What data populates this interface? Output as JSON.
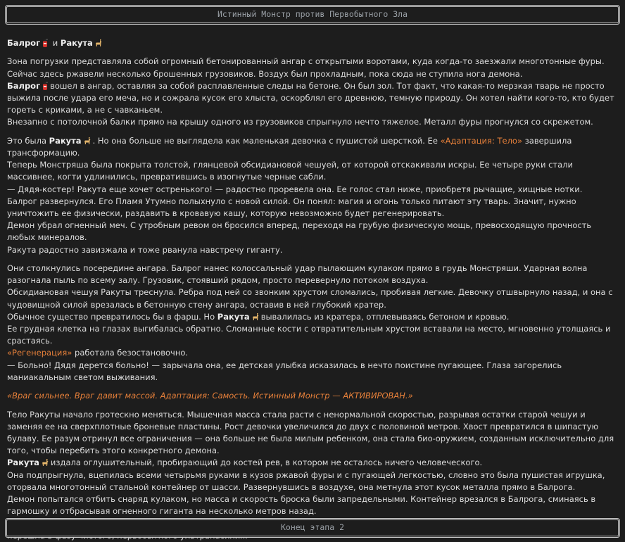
{
  "header": {
    "title": "Истинный Монстр против Первобытного Зла"
  },
  "footer": {
    "title": "Конец этапа 2"
  },
  "colors": {
    "accent": "#e8813a",
    "background": "#1d1d1d",
    "text": "#dcdcdc",
    "banner_text": "#9aa0a6"
  },
  "icons": {
    "balrog": "fire-extinguisher-icon",
    "rakuta": "llama-icon"
  },
  "participants": {
    "balrog": "Балрог",
    "conj": "и",
    "rakuta": "Ракута"
  },
  "paragraphs": [
    {
      "lines": [
        [
          {
            "t": "Зона погрузки представляла собой огромный бетонированный ангар с открытыми воротами, куда когда-то заезжали многотонные фуры. Сейчас здесь ржавели несколько брошенных грузовиков. Воздух был прохладным, пока сюда не ступила нога демона."
          }
        ],
        [
          {
            "t": "Балрог",
            "s": "b"
          },
          {
            "icon": "fire"
          },
          {
            "t": "вошел в ангар, оставляя за собой расплавленные следы на бетоне. Он был зол. Тот факт, что какая-то мерзкая тварь не просто выжила после удара его меча, но и сожрала кусок его хлыста, оскорблял его древнюю, темную природу. Он хотел найти кого-то, кто будет гореть с криками, а не с чавканьем."
          }
        ],
        [
          {
            "t": "Внезапно с потолочной балки прямо на крышу одного из грузовиков спрыгнуло нечто тяжелое. Металл фуры прогнулся со скрежетом."
          }
        ]
      ]
    },
    {
      "lines": [
        [
          {
            "t": "Это была "
          },
          {
            "t": "Ракута",
            "s": "b"
          },
          {
            "icon": "llama"
          },
          {
            "t": ". Но она больше не выглядела как маленькая девочка с пушистой шерсткой. Ее "
          },
          {
            "t": "«Адаптация: Тело»",
            "s": "acc"
          },
          {
            "t": " завершила трансформацию."
          }
        ],
        [
          {
            "t": "Теперь Монстряша была покрыта толстой, глянцевой обсидиановой чешуей, от которой отскакивали искры. Ее четыре руки стали массивнее, когти удлинились, превратившись в изогнутые черные сабли."
          }
        ],
        [
          {
            "t": "— Дядя-костер! Ракута еще хочет остренького! — радостно проревела она. Ее голос стал ниже, приобретя рычащие, хищные нотки."
          }
        ],
        [
          {
            "t": "Балрог развернулся. Его Пламя Утумно полыхнуло с новой силой. Он понял: магия и огонь только питают эту тварь. Значит, нужно уничтожить ее физически, раздавить в кровавую кашу, которую невозможно будет регенерировать."
          }
        ],
        [
          {
            "t": "Демон убрал огненный меч. С утробным ревом он бросился вперед, переходя на грубую физическую мощь, превосходящую прочность любых минералов."
          }
        ],
        [
          {
            "t": "Ракута радостно завизжала и тоже рванула навстречу гиганту."
          }
        ]
      ]
    },
    {
      "lines": [
        [
          {
            "t": "Они столкнулись посередине ангара. Балрог нанес колоссальный удар пылающим кулаком прямо в грудь Монстряши. Ударная волна разогнала пыль по всему залу. Грузовик, стоявший рядом, просто перевернуло потоком воздуха."
          }
        ],
        [
          {
            "t": "Обсидиановая чешуя Ракуты треснула. Ребра под ней со звонким хрустом сломались, пробивая легкие. Девочку отшвырнуло назад, и она с чудовищной силой врезалась в бетонную стену ангара, оставив в ней глубокий кратер."
          }
        ],
        [
          {
            "t": "Обычное существо превратилось бы в фарш. Но "
          },
          {
            "t": "Ракута",
            "s": "b"
          },
          {
            "icon": "llama"
          },
          {
            "t": "вывалилась из кратера, отплевываясь бетоном и кровью."
          }
        ],
        [
          {
            "t": "Ее грудная клетка на глазах выгибалась обратно. Сломанные кости с отвратительным хрустом вставали на место, мгновенно утолщаясь и срастаясь."
          }
        ],
        [
          {
            "t": "«Регенерация»",
            "s": "acc"
          },
          {
            "t": " работала безостановочно."
          }
        ],
        [
          {
            "t": "— Больно! Дядя дерется больно! — зарычала она, ее детская улыбка исказилась в нечто поистине пугающее. Глаза загорелись маниакальным светом выживания."
          }
        ]
      ]
    },
    {
      "lines": [
        [
          {
            "t": "«Враг сильнее. Враг давит массой. Адаптация: Самость. Истинный Монстр — АКТИВИРОВАН.»",
            "s": "acc-i"
          }
        ]
      ]
    },
    {
      "lines": [
        [
          {
            "t": "Тело Ракуты начало гротескно меняться. Мышечная масса стала расти с ненормальной скоростью, разрывая остатки старой чешуи и заменяя ее на сверхплотные броневые пластины. Рост девочки увеличился до двух с половиной метров. Хвост превратился в шипастую булаву. Ее разум отринул все ограничения — она больше не была милым ребенком, она стала био-оружием, созданным исключительно для того, чтобы перебить этого конкретного демона."
          }
        ],
        [
          {
            "t": "Ракута",
            "s": "b"
          },
          {
            "icon": "llama"
          },
          {
            "t": "издала оглушительный, пробирающий до костей рев, в котором не осталось ничего человеческого."
          }
        ],
        [
          {
            "t": "Она подпрыгнула, вцепилась всеми четырьмя руками в кузов ржавой фуры и с пугающей легкостью, словно это была пушистая игрушка, оторвала многотонный стальной контейнер от шасси. Развернувшись в воздухе, она метнула этот кусок металла прямо в Балрога."
          }
        ],
        [
          {
            "t": "Демон попытался отбить снаряд кулаком, но масса и скорость броска были запредельными. Контейнер врезался в Балрога, сминаясь в гармошку и отбрасывая огненного гиганта на несколько метров назад."
          }
        ],
        [
          {
            "t": "Ракута, тяжело дыша и пуская слюни, полные кислоты, опустилась на все четыре конечности, готовясь к новому рывку. Битва титанов перешла в фазу чистого, первобытного ультранасилия."
          }
        ]
      ]
    }
  ]
}
